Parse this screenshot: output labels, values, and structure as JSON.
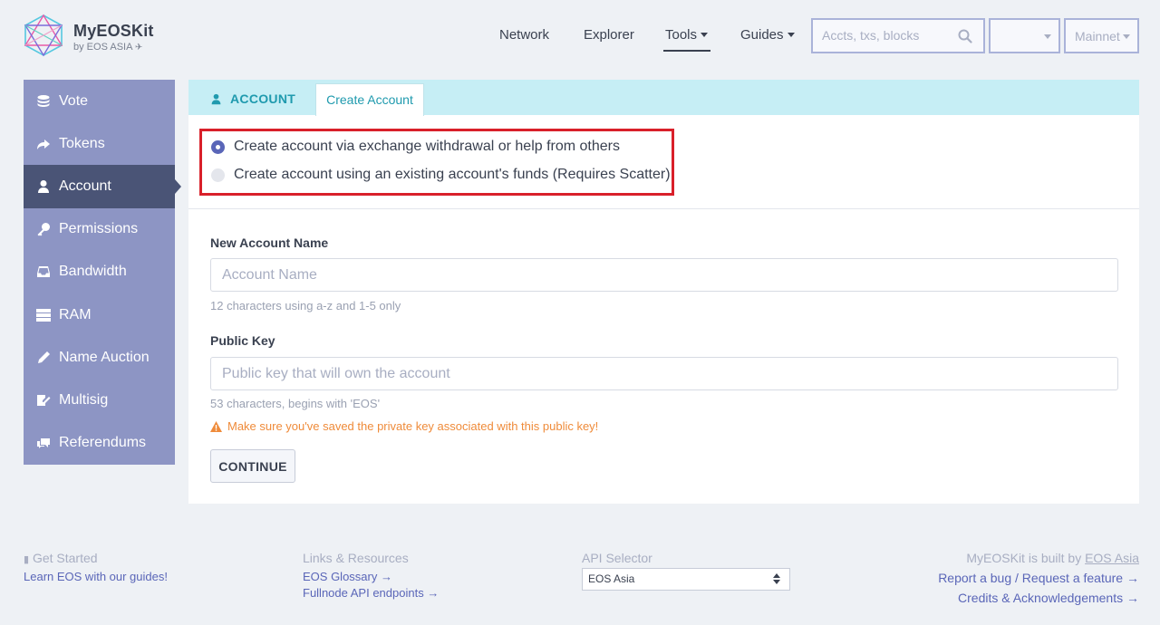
{
  "brand": {
    "name": "MyEOSKit",
    "sub": "by EOS ASIA"
  },
  "nav": {
    "items": [
      "Network",
      "Explorer",
      "Tools",
      "Guides"
    ]
  },
  "search": {
    "placeholder": "Accts, txs, blocks"
  },
  "network_select": {
    "value": "Mainnet"
  },
  "sidebar": {
    "items": [
      {
        "label": "Vote",
        "icon": "coins-icon"
      },
      {
        "label": "Tokens",
        "icon": "arrow-share-icon"
      },
      {
        "label": "Account",
        "icon": "user-icon",
        "active": true
      },
      {
        "label": "Permissions",
        "icon": "key-icon"
      },
      {
        "label": "Bandwidth",
        "icon": "inbox-icon"
      },
      {
        "label": "RAM",
        "icon": "server-icon"
      },
      {
        "label": "Name Auction",
        "icon": "pencil-icon"
      },
      {
        "label": "Multisig",
        "icon": "signature-icon"
      },
      {
        "label": "Referendums",
        "icon": "comments-icon"
      }
    ]
  },
  "tabs": {
    "section": "ACCOUNT",
    "active": "Create Account"
  },
  "options": {
    "via_exchange": "Create account via exchange withdrawal or help from others",
    "via_funds": "Create account using an existing account's funds (Requires Scatter)"
  },
  "form": {
    "account_name": {
      "label": "New Account Name",
      "placeholder": "Account Name",
      "help": "12 characters using a-z and 1-5 only"
    },
    "public_key": {
      "label": "Public Key",
      "placeholder": "Public key that will own the account",
      "help": "53 characters, begins with 'EOS'"
    },
    "warning": "Make sure you've saved the private key associated with this public key!",
    "continue_label": "CONTINUE"
  },
  "footer": {
    "get_started": {
      "heading": "Get Started",
      "link": "Learn EOS with our guides!"
    },
    "links": {
      "heading": "Links & Resources",
      "items": [
        "EOS Glossary →",
        "Fullnode API endpoints →"
      ]
    },
    "api": {
      "heading": "API Selector",
      "value": "EOS Asia"
    },
    "credits": {
      "built_prefix": "MyEOSKit is built by ",
      "built_link": "EOS Asia",
      "items": [
        "Report a bug / Request a feature →",
        "Credits & Acknowledgements →"
      ]
    }
  },
  "colors": {
    "accent": "#5a66b8",
    "sidebar": "#8d95c4",
    "sidebar_active": "#4a5476",
    "tab_bg": "#c6eef5",
    "highlight": "#d9202a",
    "warning": "#ef8b3a"
  }
}
